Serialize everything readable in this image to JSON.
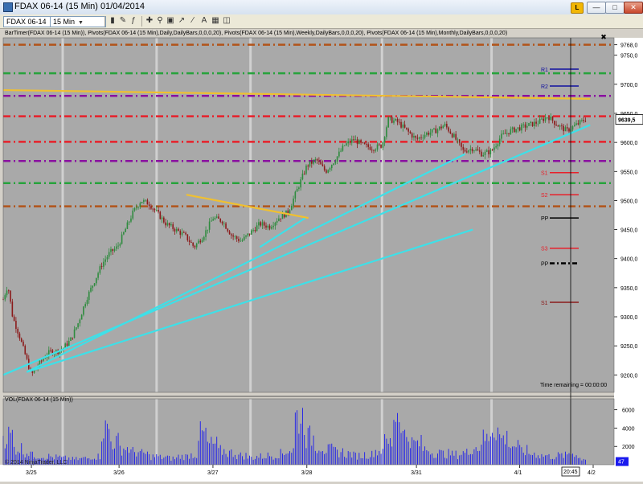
{
  "window": {
    "title": "FDAX 06-14 (15 Min)  01/04/2014",
    "logo_text": "L"
  },
  "toolbar": {
    "instrument": "FDAX 06-14",
    "interval": "15 Min"
  },
  "chart_header": "BarTimer(FDAX 06-14 (15 Min)), Pivots(FDAX 06-14 (15 Min),Daily,DailyBars,0,0,0,20), Pivots(FDAX 06-14 (15 Min),Weekly,DailyBars,0,0,0,20), Pivots(FDAX 06-14 (15 Min),Monthly,DailyBars,0,0,0,20)",
  "volume_label": "VOL(FDAX 06-14 (15 Min))",
  "copyright": "© 2014 NinjaTrader, LLC",
  "time_remaining": "Time remaining = 00:00:00",
  "last_price": "9639,5",
  "last_volume": "47",
  "crosshair_time": "20:45",
  "pivot_labels": [
    "R1",
    "R2",
    "S1",
    "S2",
    "PP",
    "S3",
    "PP",
    "S1"
  ],
  "price_ticks": [
    "9768,0",
    "9750,0",
    "9700,0",
    "9650,0",
    "9600,0",
    "9550,0",
    "9500,0",
    "9450,0",
    "9400,0",
    "9350,0",
    "9300,0",
    "9250,0",
    "9200,0"
  ],
  "volume_ticks": [
    "6000",
    "4000",
    "2000"
  ],
  "date_ticks": [
    "3/25",
    "3/26",
    "3/27",
    "3/28",
    "3/31",
    "4/1",
    "4/2"
  ],
  "colors": {
    "background": "#a9a9a9",
    "up_candle": "#2e8b3e",
    "down_candle": "#8b1a1a",
    "trendline_cyan": "#3ee0e8",
    "trendline_yellow": "#f0c030",
    "pivot_red": "#e8202a",
    "pivot_green": "#27a33c",
    "pivot_purple": "#8a10a0",
    "pivot_brown": "#b2541a",
    "volume_bar": "#1a1aee"
  },
  "chart_data": {
    "type": "candlestick",
    "instrument": "FDAX 06-14",
    "interval": "15 Min",
    "ylim": [
      9170,
      9780
    ],
    "volume_ylim": [
      0,
      7200
    ],
    "session_dates": [
      "3/25",
      "3/26",
      "3/27",
      "3/28",
      "3/31",
      "4/1",
      "4/2"
    ],
    "price_path": [
      [
        0,
        9330
      ],
      [
        0.3,
        9355
      ],
      [
        0.6,
        9300
      ],
      [
        1,
        9270
      ],
      [
        1.4,
        9235
      ],
      [
        1.8,
        9200
      ],
      [
        2.2,
        9215
      ],
      [
        2.6,
        9230
      ],
      [
        3,
        9240
      ],
      [
        3.4,
        9240
      ],
      [
        3.8,
        9245
      ],
      [
        4.3,
        9260
      ],
      [
        4.8,
        9290
      ],
      [
        5.3,
        9330
      ],
      [
        5.8,
        9360
      ],
      [
        6.3,
        9390
      ],
      [
        6.8,
        9410
      ],
      [
        7.3,
        9420
      ],
      [
        7.8,
        9450
      ],
      [
        8.3,
        9480
      ],
      [
        8.8,
        9500
      ],
      [
        9.3,
        9495
      ],
      [
        9.8,
        9480
      ],
      [
        10.4,
        9460
      ],
      [
        11,
        9450
      ],
      [
        11.6,
        9440
      ],
      [
        12.2,
        9420
      ],
      [
        12.8,
        9440
      ],
      [
        13.4,
        9470
      ],
      [
        14,
        9465
      ],
      [
        14.6,
        9440
      ],
      [
        15.2,
        9430
      ],
      [
        15.8,
        9445
      ],
      [
        16.4,
        9460
      ],
      [
        17,
        9455
      ],
      [
        17.6,
        9470
      ],
      [
        18.2,
        9480
      ],
      [
        18.8,
        9520
      ],
      [
        19.4,
        9560
      ],
      [
        20,
        9570
      ],
      [
        20.6,
        9550
      ],
      [
        21.2,
        9570
      ],
      [
        21.8,
        9595
      ],
      [
        22.4,
        9605
      ],
      [
        23,
        9595
      ],
      [
        23.6,
        9590
      ],
      [
        24.2,
        9595
      ],
      [
        24.6,
        9640
      ],
      [
        25.2,
        9635
      ],
      [
        25.8,
        9620
      ],
      [
        26.4,
        9605
      ],
      [
        27,
        9615
      ],
      [
        27.6,
        9620
      ],
      [
        28.2,
        9630
      ],
      [
        28.8,
        9610
      ],
      [
        29.4,
        9585
      ],
      [
        30,
        9590
      ],
      [
        30.6,
        9580
      ],
      [
        31.2,
        9585
      ],
      [
        31.8,
        9610
      ],
      [
        32.4,
        9620
      ],
      [
        33,
        9625
      ],
      [
        33.6,
        9630
      ],
      [
        34.2,
        9635
      ],
      [
        34.8,
        9645
      ],
      [
        35.4,
        9630
      ],
      [
        36,
        9620
      ],
      [
        36.6,
        9630
      ],
      [
        37.2,
        9640
      ]
    ],
    "volume_profile": [
      3200,
      1800,
      1400,
      1000,
      900,
      800,
      700,
      600,
      700,
      900,
      3900,
      2500,
      1800,
      1400,
      1200,
      900,
      800,
      700,
      900,
      1100,
      3300,
      2200,
      1500,
      1300,
      1000,
      800,
      900,
      1000,
      1200,
      1600,
      5200,
      3000,
      2100,
      1600,
      1400,
      1200,
      1000,
      1100,
      1500,
      2400,
      5700,
      3200,
      2300,
      1700,
      1300,
      1200,
      1100,
      1300,
      1900,
      2800,
      4100,
      2900,
      2100,
      1500,
      1200,
      1000,
      900,
      1000,
      1300,
      700
    ],
    "pivot_lines": [
      {
        "price": 9768,
        "color": "brown"
      },
      {
        "price": 9719,
        "color": "green"
      },
      {
        "price": 9680,
        "color": "purple"
      },
      {
        "price": 9645,
        "color": "red"
      },
      {
        "price": 9601,
        "color": "red"
      },
      {
        "price": 9568,
        "color": "purple"
      },
      {
        "price": 9530,
        "color": "green"
      },
      {
        "price": 9490,
        "color": "brown"
      }
    ],
    "trendlines": [
      {
        "color": "cyan",
        "from": [
          9200,
          0
        ],
        "to": [
          9630,
          37.5
        ]
      },
      {
        "color": "cyan",
        "from": [
          9205,
          1.5
        ],
        "to": [
          9580,
          29.5
        ]
      },
      {
        "color": "cyan",
        "from": [
          9205,
          1.5
        ],
        "to": [
          9450,
          30
        ]
      },
      {
        "color": "cyan",
        "from": [
          9420,
          16.4
        ],
        "to": [
          9470,
          19.3
        ]
      },
      {
        "color": "yellow",
        "from": [
          9690,
          0
        ],
        "to": [
          9675,
          37.5
        ]
      },
      {
        "color": "yellow",
        "from": [
          9510,
          11.7
        ],
        "to": [
          9470,
          19.5
        ]
      }
    ]
  }
}
